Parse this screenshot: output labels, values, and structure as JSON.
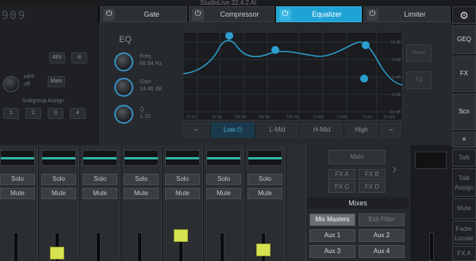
{
  "window": {
    "title": "StudioLive 32.4.2 AI"
  },
  "channel": {
    "counter": "909",
    "btn_48v": "48V",
    "btn_phase": "⊘",
    "hpf_label": "HPF",
    "hpf_value": "off",
    "main_btn": "Main",
    "subgroup_label": "Subgroup Assign",
    "subgroups": [
      "1",
      "2",
      "3",
      "4"
    ]
  },
  "tabs": [
    {
      "label": "Gate",
      "active": false
    },
    {
      "label": "Compressor",
      "active": false
    },
    {
      "label": "Equalizer",
      "active": true
    },
    {
      "label": "Limiter",
      "active": false
    }
  ],
  "eq": {
    "title": "EQ",
    "freq_label": "Freq",
    "freq_value": "68.94 Hz",
    "gain_label": "Gain",
    "gain_value": "14.46 dB",
    "q_label": "Q",
    "q_value": "1.70",
    "db_ticks": [
      "12 dB",
      "6 dB",
      "0 dB",
      "-6 dB",
      "-12 dB"
    ],
    "hz_ticks": [
      "20 Hz",
      "50 Hz",
      "100 Hz",
      "200 Hz",
      "500 Hz",
      "1 kHz",
      "2 kHz",
      "5 kHz",
      "10 kHz"
    ],
    "bands": [
      {
        "label": "Low",
        "active": true
      },
      {
        "label": "L-Mid",
        "active": false
      },
      {
        "label": "H-Mid",
        "active": false
      },
      {
        "label": "High",
        "active": false
      }
    ],
    "reset_btn": "Reset",
    "eq_btn": "EQ"
  },
  "right_col": [
    {
      "label": "GEQ"
    },
    {
      "label": "FX"
    },
    {
      "label": "Scn"
    },
    {
      "label": "≡"
    },
    {
      "label": "Talk"
    },
    {
      "label": "Talk Assign"
    },
    {
      "label": "Mute"
    },
    {
      "label": "Fader Locate"
    },
    {
      "label": "FX A"
    }
  ],
  "mixer": {
    "strips": [
      {
        "solo": "Solo",
        "mute": "Mute",
        "cap_level": 0.05
      },
      {
        "solo": "Solo",
        "mute": "Mute",
        "cap_level": 0.15
      },
      {
        "solo": "Solo",
        "mute": "Mute",
        "cap_level": 0.1
      },
      {
        "solo": "Solo",
        "mute": "Mute",
        "cap_level": 0.25
      },
      {
        "solo": "Solo",
        "mute": "Mute",
        "cap_level": 0.4
      },
      {
        "solo": "Solo",
        "mute": "Mute",
        "cap_level": 0.05
      },
      {
        "solo": "Solo",
        "mute": "Mute",
        "cap_level": 0.1
      }
    ]
  },
  "routing": {
    "main": "Main",
    "fx_a": "FX A",
    "fx_b": "FX B",
    "fx_c": "FX C",
    "fx_d": "FX D",
    "mixes_title": "Mixes",
    "mix_masters": "Mix Masters",
    "exit_filter": "Exit Filter",
    "aux": [
      "Aux 1",
      "Aux 2",
      "Aux 3",
      "Aux 4"
    ]
  }
}
